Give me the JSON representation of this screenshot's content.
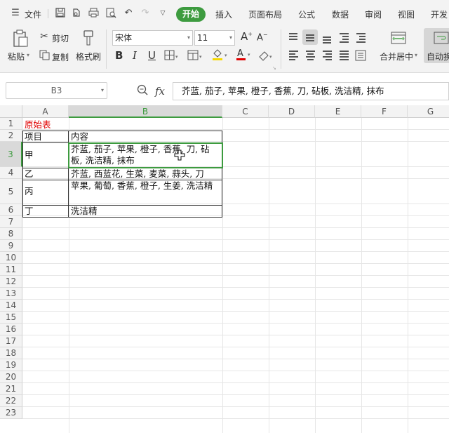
{
  "menu": {
    "file_label": "文件",
    "tabs": [
      "开始",
      "插入",
      "页面布局",
      "公式",
      "数据",
      "审阅",
      "视图",
      "开发"
    ]
  },
  "ribbon": {
    "paste_label": "粘贴",
    "cut_label": "剪切",
    "copy_label": "复制",
    "format_painter_label": "格式刷",
    "font_name": "宋体",
    "font_size": "11",
    "merge_center_label": "合并居中",
    "auto_wrap_label": "自动换"
  },
  "formula_bar": {
    "cell_ref": "B3",
    "fx_label": "fx",
    "content": "芥蓝, 茄子, 苹果, 橙子, 香蕉, 刀, 砧板, 洗洁精, 抹布"
  },
  "columns": [
    "A",
    "B",
    "C",
    "D",
    "E",
    "F",
    "G"
  ],
  "rows": [
    "1",
    "2",
    "3",
    "4",
    "5",
    "6",
    "7",
    "8",
    "9",
    "10",
    "11",
    "12",
    "13",
    "14",
    "15",
    "16",
    "17",
    "18",
    "19",
    "20",
    "21",
    "22",
    "23"
  ],
  "sheet": {
    "title": "原始表",
    "header": [
      "项目",
      "内容"
    ],
    "data": [
      [
        "甲",
        "芥蓝, 茄子, 苹果, 橙子, 香蕉, 刀, 砧板, 洗洁精, 抹布"
      ],
      [
        "乙",
        "芥蓝, 西蓝花, 生菜, 麦菜, 蒜头, 刀"
      ],
      [
        "丙",
        "苹果, 葡萄, 香蕉, 橙子, 生姜, 洗洁精"
      ],
      [
        "丁",
        "洗洁精"
      ]
    ]
  },
  "colors": {
    "accent": "#3d9b3f",
    "title_red": "#e00000"
  }
}
